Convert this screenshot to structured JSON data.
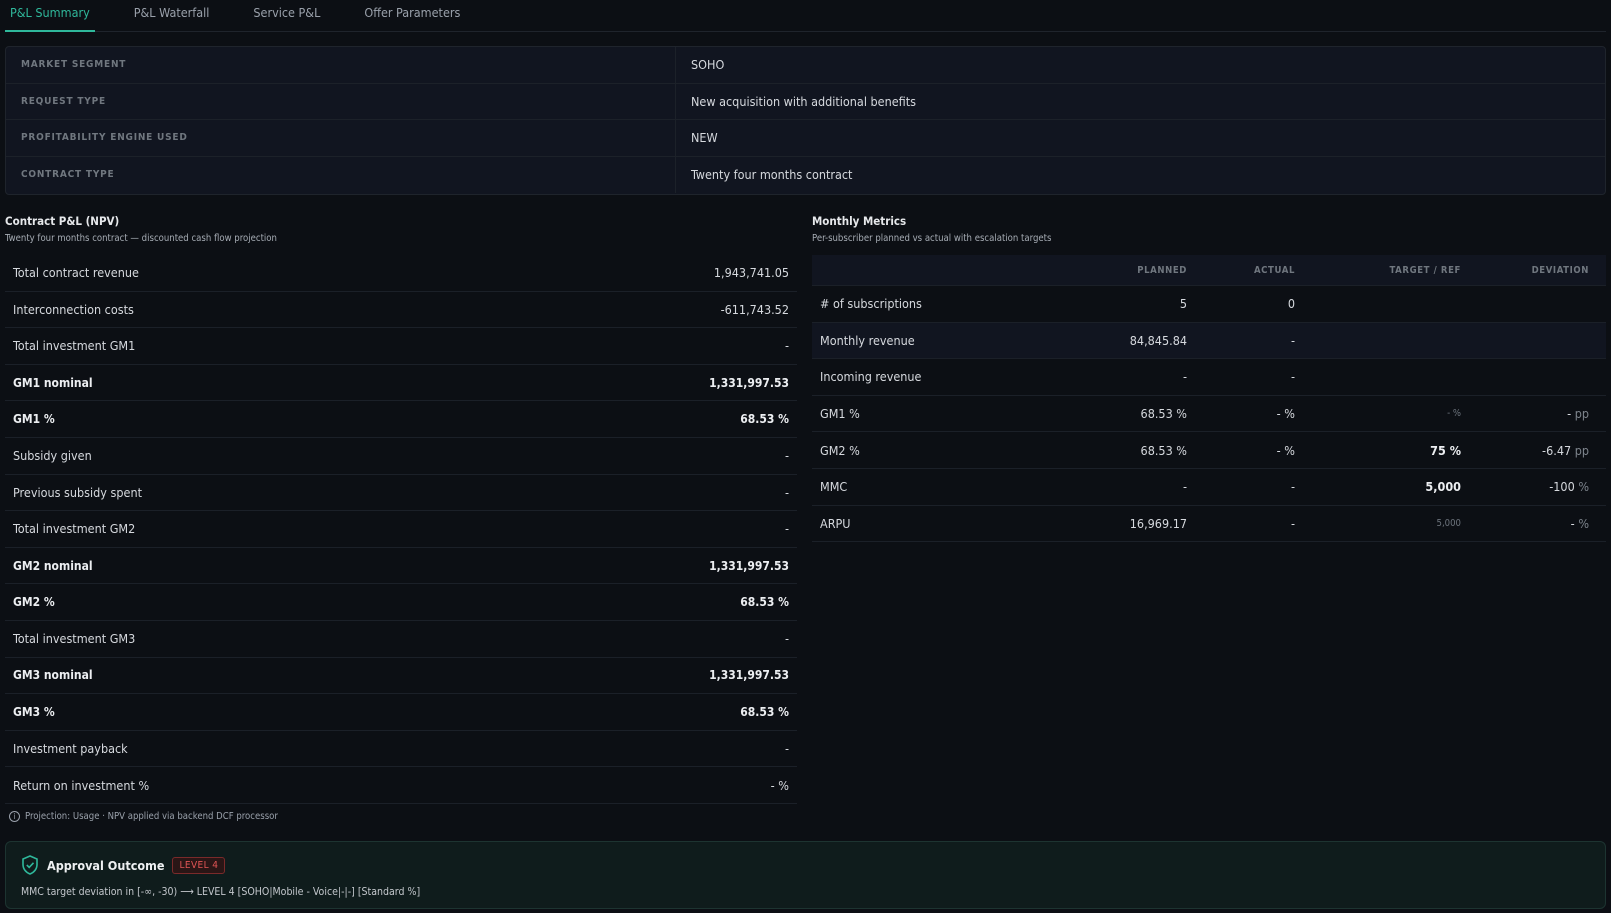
{
  "tabs": [
    {
      "label": "P&L Summary",
      "active": true
    },
    {
      "label": "P&L Waterfall",
      "active": false
    },
    {
      "label": "Service P&L",
      "active": false
    },
    {
      "label": "Offer Parameters",
      "active": false
    }
  ],
  "info": [
    {
      "label": "MARKET SEGMENT",
      "value": "SOHO"
    },
    {
      "label": "REQUEST TYPE",
      "value": "New acquisition with additional benefits"
    },
    {
      "label": "PROFITABILITY ENGINE USED",
      "value": "NEW"
    },
    {
      "label": "CONTRACT TYPE",
      "value": "Twenty four months contract"
    }
  ],
  "pnl": {
    "title": "Contract P&L (NPV)",
    "subtitle": "Twenty four months contract — discounted cash flow projection",
    "rows": [
      {
        "label": "Total contract revenue",
        "value": "1,943,741.05",
        "bold": false
      },
      {
        "label": "Interconnection costs",
        "value": "-611,743.52",
        "bold": false
      },
      {
        "label": "Total investment GM1",
        "value": "-",
        "bold": false
      },
      {
        "label": "GM1 nominal",
        "value": "1,331,997.53",
        "bold": true
      },
      {
        "label": "GM1 %",
        "value": "68.53 %",
        "bold": true
      },
      {
        "label": "Subsidy given",
        "value": "-",
        "bold": false
      },
      {
        "label": "Previous subsidy spent",
        "value": "-",
        "bold": false
      },
      {
        "label": "Total investment GM2",
        "value": "-",
        "bold": false
      },
      {
        "label": "GM2 nominal",
        "value": "1,331,997.53",
        "bold": true
      },
      {
        "label": "GM2 %",
        "value": "68.53 %",
        "bold": true
      },
      {
        "label": "Total investment GM3",
        "value": "-",
        "bold": false
      },
      {
        "label": "GM3 nominal",
        "value": "1,331,997.53",
        "bold": true
      },
      {
        "label": "GM3 %",
        "value": "68.53 %",
        "bold": true
      },
      {
        "label": "Investment payback",
        "value": "-",
        "bold": false
      },
      {
        "label": "Return on investment %",
        "value": "- %",
        "bold": false
      }
    ],
    "projection_label": "Projection:",
    "projection_value": "Usage",
    "projection_note": "· NPV applied via backend DCF processor"
  },
  "metrics": {
    "title": "Monthly Metrics",
    "subtitle": "Per-subscriber planned vs actual with escalation targets",
    "headers": [
      "",
      "PLANNED",
      "ACTUAL",
      "TARGET / REF",
      "DEVIATION"
    ],
    "rows": [
      {
        "name": "# of subscriptions",
        "planned": "5",
        "actual": "0",
        "target": "",
        "target_style": "",
        "deviation": "",
        "deviation_unit": "",
        "shade": false
      },
      {
        "name": "Monthly revenue",
        "planned": "84,845.84",
        "actual": "-",
        "target": "",
        "target_style": "",
        "deviation": "",
        "deviation_unit": "",
        "shade": true
      },
      {
        "name": "Incoming revenue",
        "planned": "-",
        "actual": "-",
        "target": "",
        "target_style": "",
        "deviation": "",
        "deviation_unit": "",
        "shade": false
      },
      {
        "name": "GM1 %",
        "planned": "68.53 %",
        "actual": "- %",
        "target": "- %",
        "target_style": "dim",
        "deviation": "-",
        "deviation_unit": "pp",
        "shade": false
      },
      {
        "name": "GM2 %",
        "planned": "68.53 %",
        "actual": "- %",
        "target": "75 %",
        "target_style": "strong",
        "deviation": "-6.47",
        "deviation_unit": "pp",
        "shade": false
      },
      {
        "name": "MMC",
        "planned": "-",
        "actual": "-",
        "target": "5,000",
        "target_style": "strong",
        "deviation": "-100",
        "deviation_unit": "%",
        "shade": false
      },
      {
        "name": "ARPU",
        "planned": "16,969.17",
        "actual": "-",
        "target": "5,000",
        "target_style": "dim",
        "deviation": "-",
        "deviation_unit": "%",
        "shade": false
      }
    ]
  },
  "approval": {
    "title": "Approval Outcome",
    "level": "LEVEL 4",
    "text": "MMC target deviation in [-∞, -30) ⟶ LEVEL 4 [SOHO|Mobile - Voice|-|-] [Standard %]",
    "accent_color": "#2fb89b",
    "level_color": "#e25555"
  }
}
